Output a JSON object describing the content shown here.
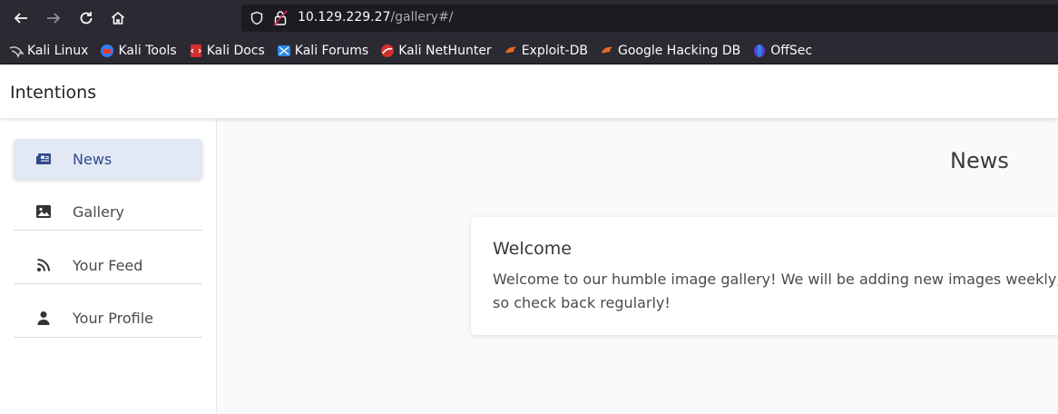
{
  "browser": {
    "url_host": "10.129.229.27",
    "url_path": "/gallery#/",
    "bookmarks": [
      {
        "label": "Kali Linux",
        "icon": "kali-dragon-icon"
      },
      {
        "label": "Kali Tools",
        "icon": "kali-tools-icon"
      },
      {
        "label": "Kali Docs",
        "icon": "kali-docs-icon"
      },
      {
        "label": "Kali Forums",
        "icon": "kali-forums-icon"
      },
      {
        "label": "Kali NetHunter",
        "icon": "kali-nethunter-icon"
      },
      {
        "label": "Exploit-DB",
        "icon": "exploit-db-icon"
      },
      {
        "label": "Google Hacking DB",
        "icon": "ghdb-icon"
      },
      {
        "label": "OffSec",
        "icon": "offsec-icon"
      }
    ]
  },
  "app": {
    "title": "Intentions"
  },
  "sidebar": {
    "items": [
      {
        "label": "News",
        "icon": "newspaper-icon",
        "active": true
      },
      {
        "label": "Gallery",
        "icon": "image-icon",
        "active": false
      },
      {
        "label": "Your Feed",
        "icon": "rss-icon",
        "active": false
      },
      {
        "label": "Your Profile",
        "icon": "person-icon",
        "active": false
      }
    ]
  },
  "main": {
    "heading": "News",
    "card": {
      "title": "Welcome",
      "body": "Welcome to our humble image gallery! We will be adding new images weekly, so check back regularly!"
    }
  },
  "colors": {
    "browser_chrome": "#2b2a33",
    "urlbar": "#1c1b22",
    "active_item_bg": "#e3e8f5",
    "active_item_text": "#2f4a8a"
  }
}
